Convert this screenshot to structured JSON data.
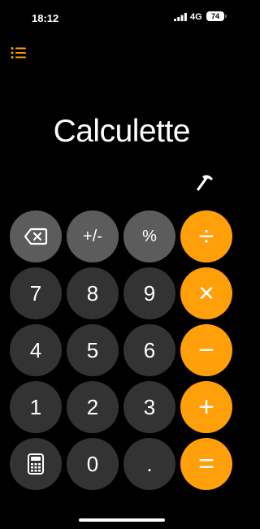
{
  "status_bar": {
    "time": "18:12",
    "network": "4G",
    "battery": "74"
  },
  "display": {
    "text": "Calculette"
  },
  "keypad": {
    "rows": [
      [
        {
          "name": "backspace-button",
          "label": "",
          "icon": "backspace-icon",
          "style": "light"
        },
        {
          "name": "plus-minus-button",
          "label": "+/-",
          "style": "light"
        },
        {
          "name": "percent-button",
          "label": "%",
          "style": "light"
        },
        {
          "name": "divide-button",
          "label": "÷",
          "style": "op"
        }
      ],
      [
        {
          "name": "digit-7-button",
          "label": "7",
          "style": "dark"
        },
        {
          "name": "digit-8-button",
          "label": "8",
          "style": "dark"
        },
        {
          "name": "digit-9-button",
          "label": "9",
          "style": "dark"
        },
        {
          "name": "multiply-button",
          "label": "×",
          "style": "op"
        }
      ],
      [
        {
          "name": "digit-4-button",
          "label": "4",
          "style": "dark"
        },
        {
          "name": "digit-5-button",
          "label": "5",
          "style": "dark"
        },
        {
          "name": "digit-6-button",
          "label": "6",
          "style": "dark"
        },
        {
          "name": "minus-button",
          "label": "−",
          "style": "op"
        }
      ],
      [
        {
          "name": "digit-1-button",
          "label": "1",
          "style": "dark"
        },
        {
          "name": "digit-2-button",
          "label": "2",
          "style": "dark"
        },
        {
          "name": "digit-3-button",
          "label": "3",
          "style": "dark"
        },
        {
          "name": "plus-button",
          "label": "+",
          "style": "op"
        }
      ],
      [
        {
          "name": "calculator-mode-button",
          "label": "",
          "icon": "calculator-icon",
          "style": "dark"
        },
        {
          "name": "digit-0-button",
          "label": "0",
          "style": "dark"
        },
        {
          "name": "decimal-button",
          "label": ".",
          "style": "dark"
        },
        {
          "name": "equals-button",
          "label": "=",
          "style": "op"
        }
      ]
    ]
  },
  "colors": {
    "background": "#000000",
    "accent": "#ff9f0a",
    "key_dark": "#333333",
    "key_light": "#5c5c5c",
    "text": "#ffffff"
  },
  "icons": {
    "menu": "list-icon",
    "display_accessory": "pick-icon"
  }
}
